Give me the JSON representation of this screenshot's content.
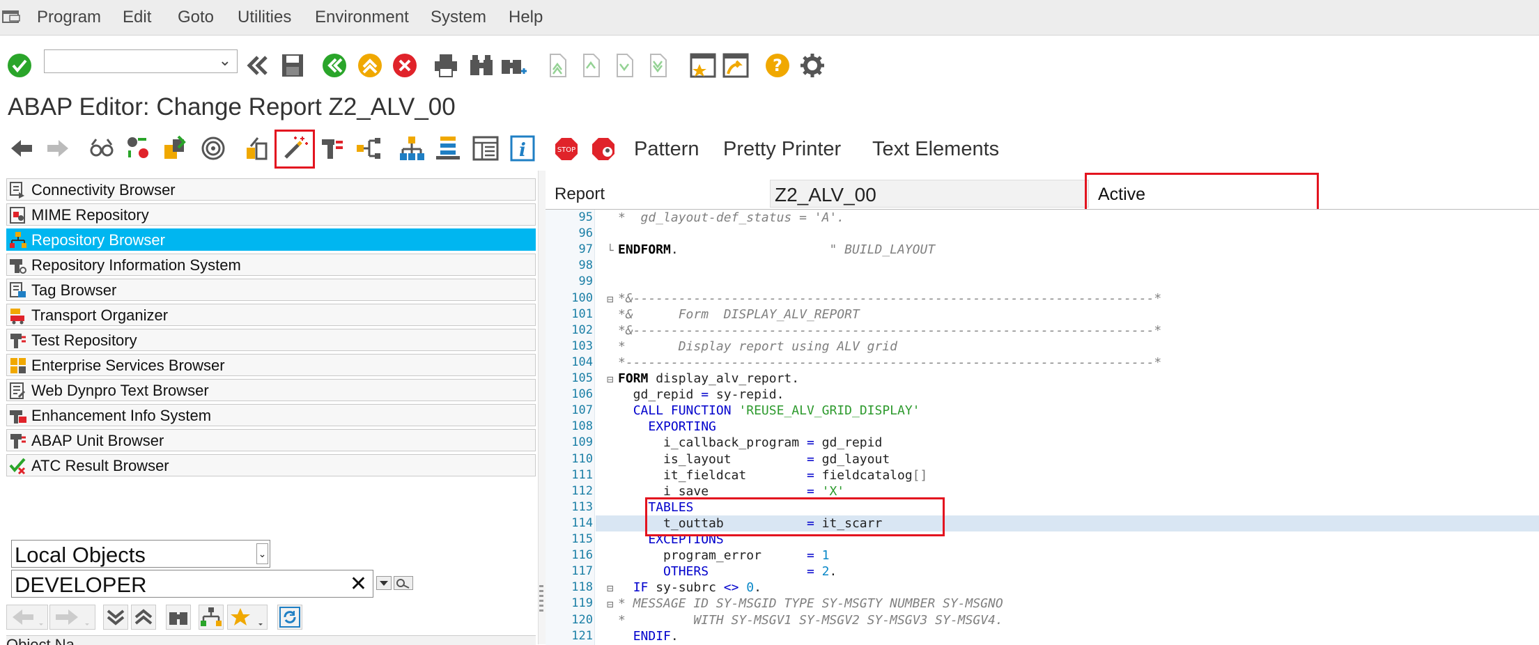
{
  "menu": {
    "items": [
      {
        "label": "Program"
      },
      {
        "label": "Edit"
      },
      {
        "label": "Goto"
      },
      {
        "label": "Utilities"
      },
      {
        "label": "Environment"
      },
      {
        "label": "System"
      },
      {
        "label": "Help"
      }
    ]
  },
  "command_field": {
    "value": ""
  },
  "title": "ABAP Editor: Change Report Z2_ALV_00",
  "app_toolbar": {
    "pattern": "Pattern",
    "pretty_printer": "Pretty Printer",
    "text_elements": "Text Elements"
  },
  "left_panel": {
    "items": [
      {
        "label": "Connectivity Browser"
      },
      {
        "label": "MIME Repository"
      },
      {
        "label": "Repository Browser"
      },
      {
        "label": "Repository Information System"
      },
      {
        "label": "Tag Browser"
      },
      {
        "label": "Transport Organizer"
      },
      {
        "label": "Test Repository"
      },
      {
        "label": "Enterprise Services Browser"
      },
      {
        "label": "Web Dynpro Text Browser"
      },
      {
        "label": "Enhancement Info System"
      },
      {
        "label": "ABAP Unit Browser"
      },
      {
        "label": "ATC Result Browser"
      }
    ],
    "selected": "Repository Browser",
    "object_type": "Local Objects",
    "user": "DEVELOPER",
    "clear_symbol": "✕",
    "object_name_header": "Object Na"
  },
  "editor": {
    "report_label": "Report",
    "report_name": "Z2_ALV_00",
    "status": "Active",
    "highlighted_line": "114",
    "lines": [
      {
        "num": "95",
        "code": "*  gd_layout-def_status = 'A'."
      },
      {
        "num": "96",
        "code": ""
      },
      {
        "num": "97",
        "code": "ENDFORM.                    \" BUILD_LAYOUT"
      },
      {
        "num": "98",
        "code": ""
      },
      {
        "num": "99",
        "code": ""
      },
      {
        "num": "100",
        "code": "*&---------------------------------------------------------------------*"
      },
      {
        "num": "101",
        "code": "*&      Form  DISPLAY_ALV_REPORT"
      },
      {
        "num": "102",
        "code": "*&---------------------------------------------------------------------*"
      },
      {
        "num": "103",
        "code": "*       Display report using ALV grid"
      },
      {
        "num": "104",
        "code": "*----------------------------------------------------------------------*"
      },
      {
        "num": "105",
        "code": "FORM display_alv_report."
      },
      {
        "num": "106",
        "code": "  gd_repid = sy-repid."
      },
      {
        "num": "107",
        "code": "  CALL FUNCTION 'REUSE_ALV_GRID_DISPLAY'"
      },
      {
        "num": "108",
        "code": "    EXPORTING"
      },
      {
        "num": "109",
        "code": "      i_callback_program = gd_repid"
      },
      {
        "num": "110",
        "code": "      is_layout          = gd_layout"
      },
      {
        "num": "111",
        "code": "      it_fieldcat        = fieldcatalog[]"
      },
      {
        "num": "112",
        "code": "      i_save             = 'X'"
      },
      {
        "num": "113",
        "code": "    TABLES"
      },
      {
        "num": "114",
        "code": "      t_outtab           = it_scarr"
      },
      {
        "num": "115",
        "code": "    EXCEPTIONS"
      },
      {
        "num": "116",
        "code": "      program_error      = 1"
      },
      {
        "num": "117",
        "code": "      OTHERS             = 2."
      },
      {
        "num": "118",
        "code": "  IF sy-subrc <> 0."
      },
      {
        "num": "119",
        "code": "* MESSAGE ID SY-MSGID TYPE SY-MSGTY NUMBER SY-MSGNO"
      },
      {
        "num": "120",
        "code": "*         WITH SY-MSGV1 SY-MSGV2 SY-MSGV3 SY-MSGV4."
      },
      {
        "num": "121",
        "code": "  ENDIF."
      }
    ]
  },
  "colors": {
    "selection": "#00b6f0",
    "highlight_box": "#e3141f",
    "line_highlight": "#d9e6f3",
    "keyword": "#0000cc",
    "string": "#2d9a2d",
    "comment": "#808080"
  }
}
